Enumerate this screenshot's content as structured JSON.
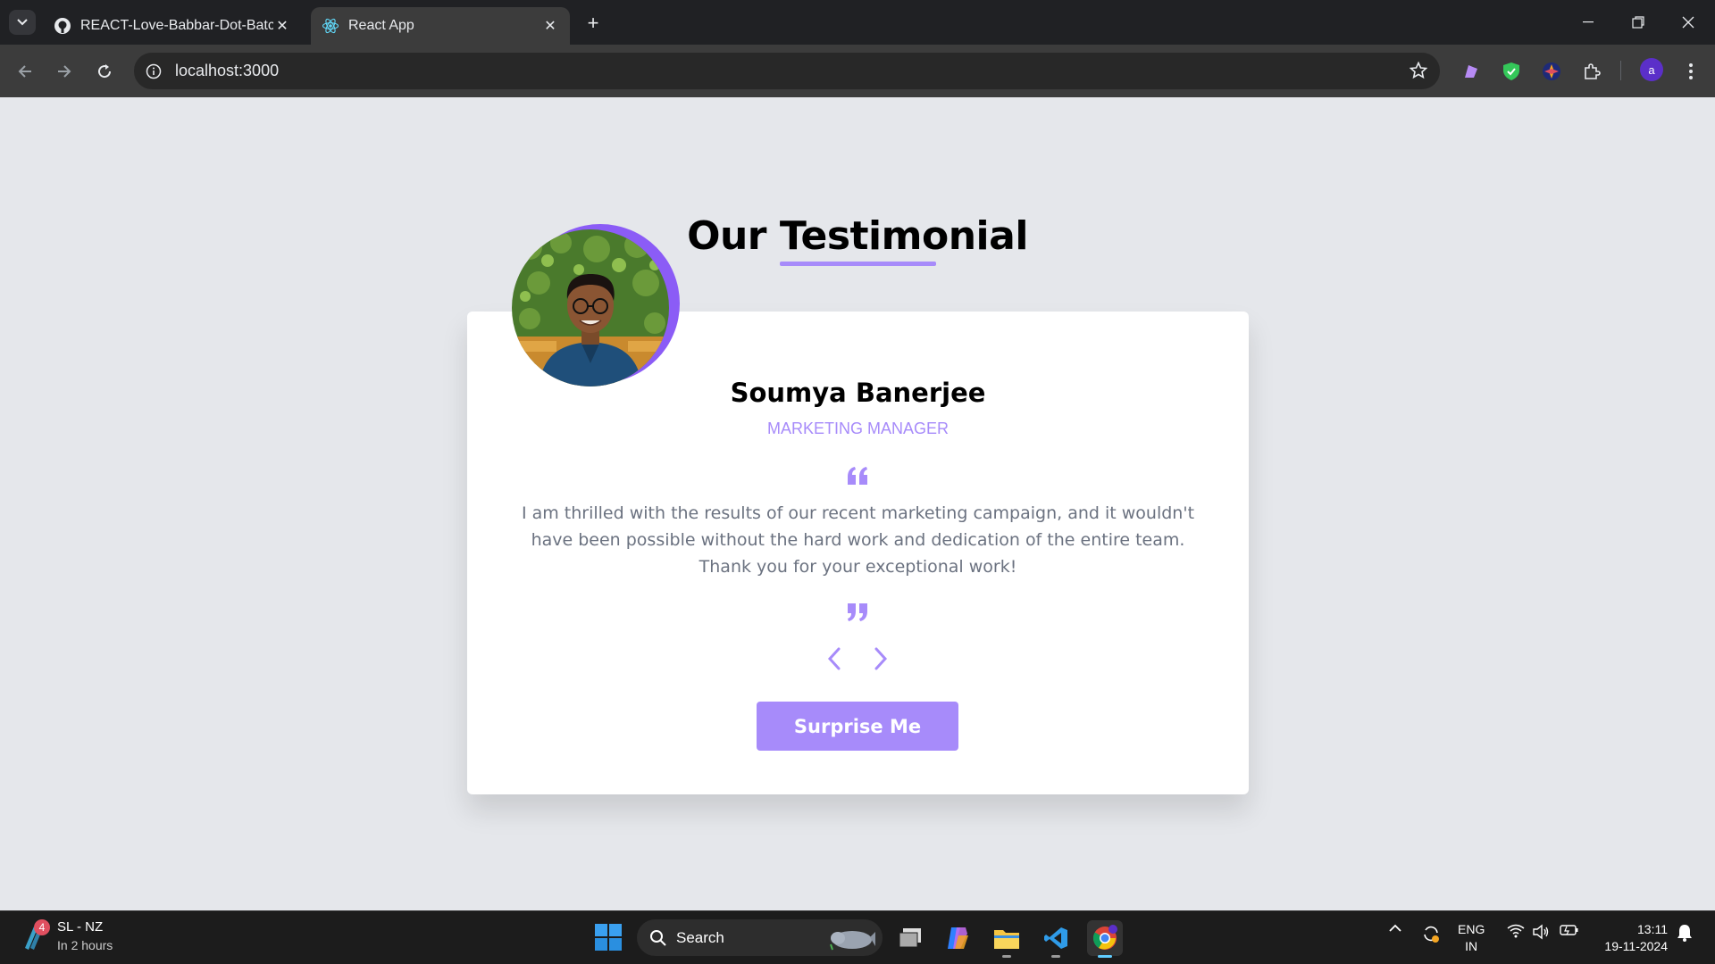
{
  "browser": {
    "tabs": [
      {
        "title": "REACT-Love-Babbar-Dot-Batch",
        "favicon": "github-icon",
        "active": false
      },
      {
        "title": "React App",
        "favicon": "react-icon",
        "active": true
      }
    ],
    "url": "localhost:3000",
    "profile_initial": "a"
  },
  "page": {
    "heading": "Our Testimonial",
    "testimonial": {
      "name": "Soumya Banerjee",
      "job": "MARKETING MANAGER",
      "text": "I am thrilled with the results of our recent marketing campaign, and it wouldn't have been possible without the hard work and dedication of the entire team. Thank you for your exceptional work!"
    },
    "surprise_label": "Surprise Me",
    "accent_color": "#a78bfa"
  },
  "taskbar": {
    "weather_title": "SL - NZ",
    "weather_sub": "In 2 hours",
    "weather_badge": "4",
    "search_label": "Search",
    "lang_line1": "ENG",
    "lang_line2": "IN",
    "time": "13:11",
    "date": "19-11-2024"
  }
}
